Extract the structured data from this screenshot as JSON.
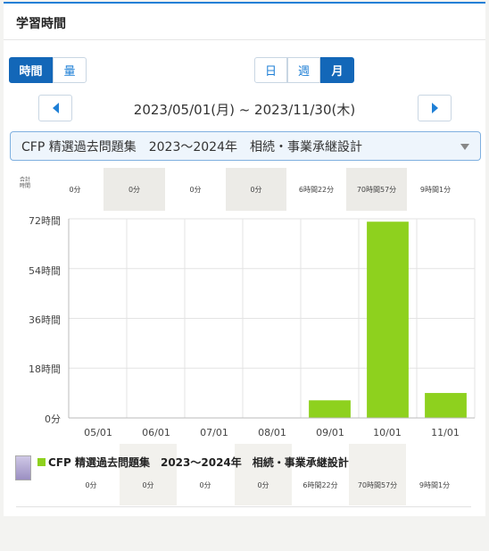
{
  "header": {
    "title": "学習時間"
  },
  "metric_toggle": [
    {
      "label": "時間",
      "active": true
    },
    {
      "label": "量",
      "active": false
    }
  ],
  "period_toggle": [
    {
      "label": "日",
      "active": false
    },
    {
      "label": "週",
      "active": false
    },
    {
      "label": "月",
      "active": true
    }
  ],
  "date_range": "2023/05/01(月) ~ 2023/11/30(木)",
  "material_select": {
    "value": "CFP 精選過去問題集　2023～2024年　相続・事業承継設計"
  },
  "totals": {
    "label": "合計\n時間",
    "values": [
      "0分",
      "0分",
      "0分",
      "0分",
      "6時間22分",
      "70時間57分",
      "9時間1分"
    ]
  },
  "chart_data": {
    "type": "bar",
    "categories": [
      "05/01",
      "06/01",
      "07/01",
      "08/01",
      "09/01",
      "10/01",
      "11/01"
    ],
    "series": [
      {
        "values": [
          0,
          0,
          0,
          0,
          6.37,
          70.95,
          9.02
        ]
      }
    ],
    "yticks": [
      "0分",
      "18時間",
      "36時間",
      "54時間",
      "72時間"
    ],
    "ylim": [
      0,
      72
    ],
    "bar_color": "#8ed11e",
    "grid": true
  },
  "legend": {
    "label": "CFP 精選過去問題集　2023～2024年　相続・事業承継設計",
    "values": [
      "0分",
      "0分",
      "0分",
      "0分",
      "6時間22分",
      "70時間57分",
      "9時間1分"
    ]
  },
  "colors": {
    "accent": "#1367b8",
    "bar": "#8ed11e"
  }
}
